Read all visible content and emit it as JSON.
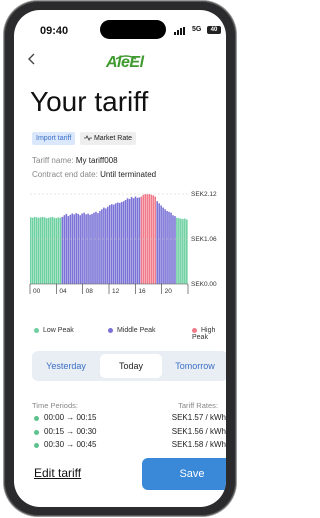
{
  "status": {
    "time": "09:40",
    "network": "5G",
    "battery": "40"
  },
  "header": {
    "back_icon": "chevron-left-icon",
    "brand": "AleEl",
    "title": "Your tariff"
  },
  "chips": {
    "import": "Import tariff",
    "market": "Market Rate",
    "market_icon": "pulse-icon"
  },
  "info": {
    "name_label": "Tariff name:",
    "name_value": "My tariff008",
    "end_label": "Contract end date:",
    "end_value": "Until terminated"
  },
  "chart_data": {
    "type": "bar",
    "x_ticks": [
      "00",
      "04",
      "08",
      "12",
      "16",
      "20"
    ],
    "y_ticks": [
      "SEK2.12",
      "SEK1.06",
      "SEK0.00"
    ],
    "ylim": [
      0,
      2.12
    ],
    "colors": {
      "low": "#6dd0a0",
      "middle": "#7a72d6",
      "high": "#f07a8a"
    },
    "legend": [
      {
        "name": "Low Peak",
        "color": "#6dd0a0"
      },
      {
        "name": "Middle Peak",
        "color": "#7a72d6"
      },
      {
        "name": "High Peak",
        "color": "#f07a8a"
      }
    ],
    "bars": [
      [
        1.57,
        "low"
      ],
      [
        1.56,
        "low"
      ],
      [
        1.58,
        "low"
      ],
      [
        1.57,
        "low"
      ],
      [
        1.56,
        "low"
      ],
      [
        1.57,
        "low"
      ],
      [
        1.58,
        "low"
      ],
      [
        1.57,
        "low"
      ],
      [
        1.55,
        "low"
      ],
      [
        1.56,
        "low"
      ],
      [
        1.57,
        "low"
      ],
      [
        1.58,
        "low"
      ],
      [
        1.56,
        "low"
      ],
      [
        1.55,
        "low"
      ],
      [
        1.57,
        "low"
      ],
      [
        1.56,
        "low"
      ],
      [
        1.58,
        "middle"
      ],
      [
        1.62,
        "middle"
      ],
      [
        1.65,
        "middle"
      ],
      [
        1.6,
        "middle"
      ],
      [
        1.63,
        "middle"
      ],
      [
        1.66,
        "middle"
      ],
      [
        1.64,
        "middle"
      ],
      [
        1.67,
        "middle"
      ],
      [
        1.65,
        "middle"
      ],
      [
        1.62,
        "middle"
      ],
      [
        1.66,
        "middle"
      ],
      [
        1.68,
        "middle"
      ],
      [
        1.64,
        "middle"
      ],
      [
        1.66,
        "middle"
      ],
      [
        1.63,
        "middle"
      ],
      [
        1.65,
        "middle"
      ],
      [
        1.68,
        "middle"
      ],
      [
        1.7,
        "middle"
      ],
      [
        1.67,
        "middle"
      ],
      [
        1.72,
        "middle"
      ],
      [
        1.76,
        "middle"
      ],
      [
        1.8,
        "middle"
      ],
      [
        1.78,
        "middle"
      ],
      [
        1.82,
        "middle"
      ],
      [
        1.86,
        "middle"
      ],
      [
        1.88,
        "middle"
      ],
      [
        1.87,
        "middle"
      ],
      [
        1.9,
        "middle"
      ],
      [
        1.92,
        "middle"
      ],
      [
        1.91,
        "middle"
      ],
      [
        1.93,
        "middle"
      ],
      [
        1.95,
        "middle"
      ],
      [
        1.98,
        "middle"
      ],
      [
        2.02,
        "middle"
      ],
      [
        2.0,
        "middle"
      ],
      [
        2.05,
        "middle"
      ],
      [
        2.02,
        "middle"
      ],
      [
        2.06,
        "middle"
      ],
      [
        2.03,
        "middle"
      ],
      [
        2.04,
        "middle"
      ],
      [
        2.06,
        "high"
      ],
      [
        2.1,
        "high"
      ],
      [
        2.12,
        "high"
      ],
      [
        2.11,
        "high"
      ],
      [
        2.12,
        "high"
      ],
      [
        2.1,
        "high"
      ],
      [
        2.09,
        "high"
      ],
      [
        2.06,
        "high"
      ],
      [
        1.95,
        "middle"
      ],
      [
        1.9,
        "middle"
      ],
      [
        1.85,
        "middle"
      ],
      [
        1.8,
        "middle"
      ],
      [
        1.76,
        "middle"
      ],
      [
        1.72,
        "middle"
      ],
      [
        1.7,
        "middle"
      ],
      [
        1.68,
        "middle"
      ],
      [
        1.62,
        "middle"
      ],
      [
        1.6,
        "middle"
      ],
      [
        1.56,
        "low"
      ],
      [
        1.55,
        "low"
      ],
      [
        1.54,
        "low"
      ],
      [
        1.53,
        "low"
      ],
      [
        1.54,
        "low"
      ],
      [
        1.52,
        "low"
      ]
    ]
  },
  "tabs": {
    "yesterday": "Yesterday",
    "today": "Today",
    "tomorrow": "Tomorrow"
  },
  "periods": {
    "left_header": "Time Periods:",
    "right_header": "Tariff Rates:",
    "rows": [
      {
        "time": "00:00 → 00:15",
        "rate": "SEK1.57 / kWh",
        "color": "#5dc28e"
      },
      {
        "time": "00:15 → 00:30",
        "rate": "SEK1.56 / kWh",
        "color": "#5dc28e"
      },
      {
        "time": "00:30 → 00:45",
        "rate": "SEK1.58 / kWh",
        "color": "#5dc28e"
      }
    ]
  },
  "actions": {
    "edit": "Edit tariff",
    "save": "Save"
  }
}
